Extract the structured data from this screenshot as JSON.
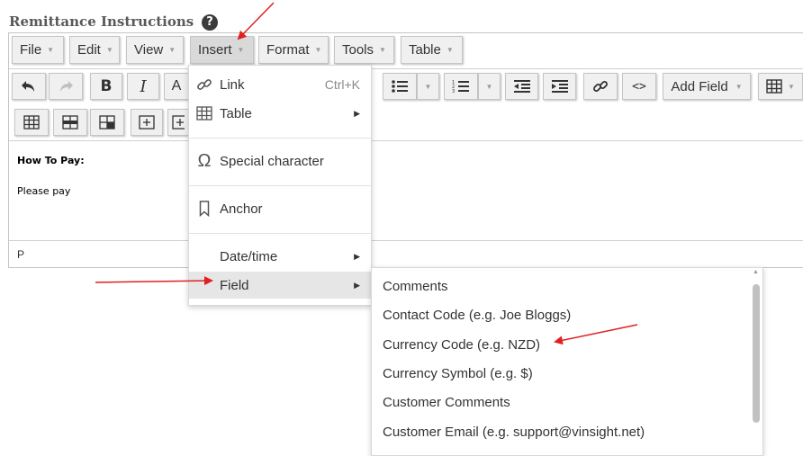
{
  "section": {
    "title": "Remittance Instructions",
    "help_glyph": "?"
  },
  "menubar": {
    "items": [
      {
        "label": "File"
      },
      {
        "label": "Edit"
      },
      {
        "label": "View"
      },
      {
        "label": "Insert"
      },
      {
        "label": "Format"
      },
      {
        "label": "Tools"
      },
      {
        "label": "Table"
      }
    ],
    "active": "Insert"
  },
  "toolbar": {
    "add_field_label": "Add Field"
  },
  "content": {
    "line1": "How To Pay:",
    "line2": "Please pay"
  },
  "statusbar": {
    "path": "P"
  },
  "insert_menu": {
    "items": [
      {
        "label": "Link",
        "shortcut": "Ctrl+K",
        "icon": "link-icon"
      },
      {
        "label": "Table",
        "icon": "table-icon"
      },
      {
        "label": "Special character",
        "icon": "omega-icon"
      },
      {
        "label": "Anchor",
        "icon": "bookmark-icon"
      },
      {
        "label": "Date/time"
      },
      {
        "label": "Field"
      }
    ],
    "highlighted": "Field"
  },
  "field_submenu": {
    "items": [
      "Comments",
      "Contact Code (e.g. Joe Bloggs)",
      "Currency Code (e.g. NZD)",
      "Currency Symbol (e.g. $)",
      "Customer Comments",
      "Customer Email (e.g. support@vinsight.net)"
    ]
  },
  "colors": {
    "annotation_arrow": "#e02020",
    "menu_highlight": "#e6e6e6",
    "button_face": "#f0f0f0"
  }
}
